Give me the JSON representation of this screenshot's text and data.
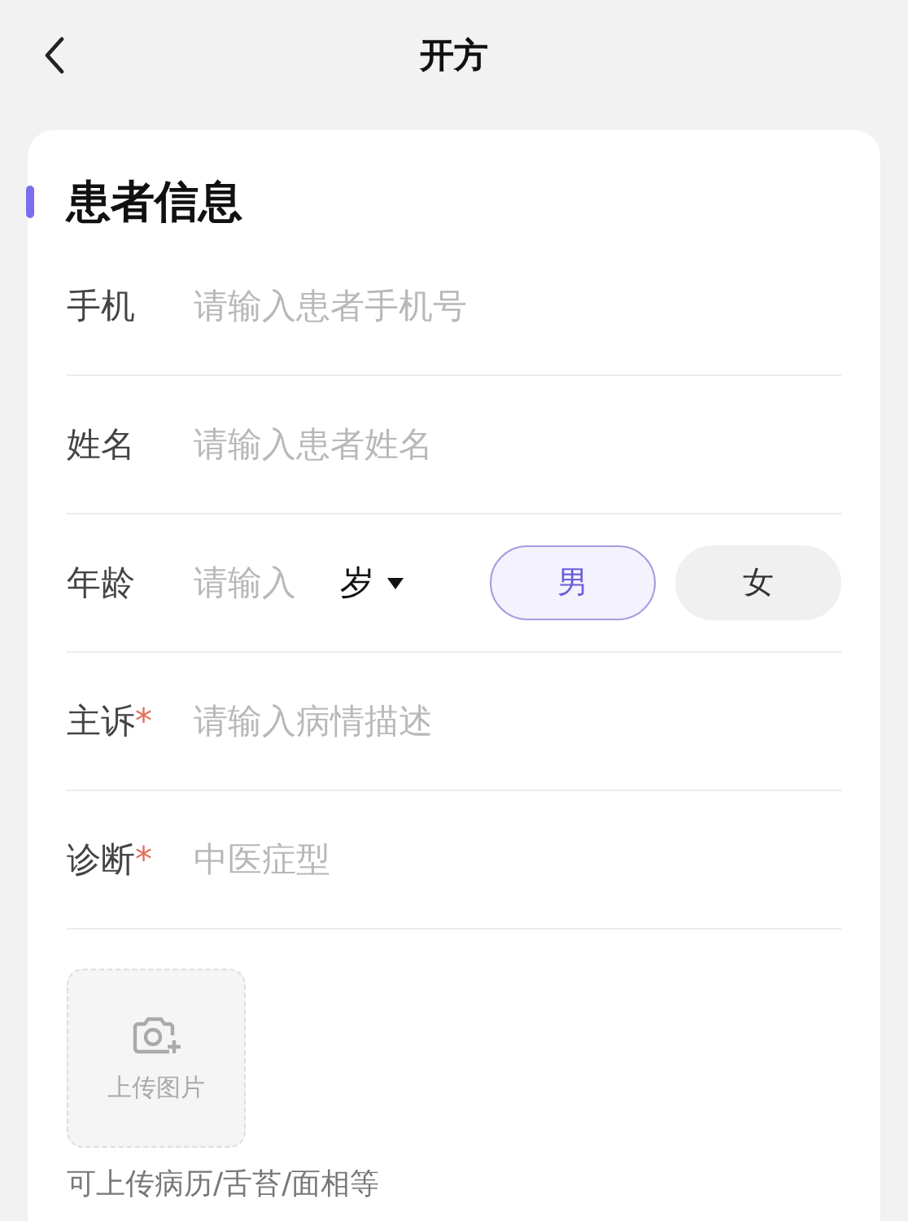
{
  "header": {
    "title": "开方"
  },
  "section": {
    "title": "患者信息"
  },
  "fields": [
    {
      "kind": "text",
      "label": "手机",
      "placeholder": "请输入患者手机号"
    },
    {
      "kind": "text",
      "label": "姓名",
      "placeholder": "请输入患者姓名"
    },
    {
      "kind": "age",
      "label": "年龄",
      "placeholder": "请输入",
      "unit": "岁",
      "genders": [
        {
          "label": "男",
          "selected": true
        },
        {
          "label": "女",
          "selected": false
        }
      ]
    },
    {
      "kind": "text",
      "label": "主诉",
      "required_mark": "*",
      "placeholder": "请输入病情描述"
    },
    {
      "kind": "text",
      "label": "诊断",
      "required_mark": "*",
      "placeholder": "中医症型"
    }
  ],
  "upload": {
    "label": "上传图片",
    "hint": "可上传病历/舌苔/面相等"
  }
}
